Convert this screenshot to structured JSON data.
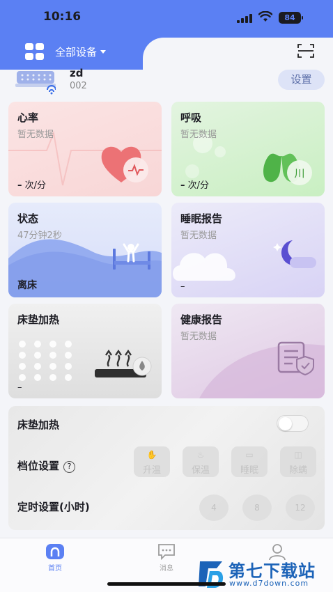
{
  "status_bar": {
    "time": "10:16",
    "battery": "84"
  },
  "header": {
    "device_selector": "全部设备"
  },
  "device": {
    "name": "zd",
    "id": "002",
    "settings_label": "设置"
  },
  "cards": {
    "heart_rate": {
      "title": "心率",
      "subtitle": "暂无数据",
      "value": "–",
      "unit": "次/分"
    },
    "breath": {
      "title": "呼吸",
      "subtitle": "暂无数据",
      "value": "–",
      "unit": "次/分"
    },
    "state": {
      "title": "状态",
      "subtitle": "47分钟2秒",
      "value": "离床"
    },
    "sleep_report": {
      "title": "睡眠报告",
      "subtitle": "暂无数据",
      "value": "–"
    },
    "mattress_heat": {
      "title": "床垫加热",
      "value": "–"
    },
    "health_report": {
      "title": "健康报告",
      "subtitle": "暂无数据"
    }
  },
  "control": {
    "heating_label": "床垫加热",
    "heating_on": false,
    "level_label": "档位设置",
    "help_symbol": "?",
    "modes": [
      "升温",
      "保温",
      "睡眠",
      "除螨"
    ],
    "timer_label": "定时设置(小时)",
    "timers": [
      "4",
      "8",
      "12"
    ]
  },
  "tabs": [
    {
      "label": "首页",
      "icon": "home-icon",
      "active": true
    },
    {
      "label": "消息",
      "icon": "message-icon",
      "active": false
    },
    {
      "label": "",
      "icon": "profile-icon",
      "active": false
    }
  ],
  "watermark": {
    "title": "第七下载站",
    "url": "www.d7down.com"
  },
  "colors": {
    "accent": "#5b80f3",
    "heart": "#f07f82",
    "breath": "#5cc054",
    "state": "#8aa3ef",
    "sleep": "#6a5fd6"
  }
}
